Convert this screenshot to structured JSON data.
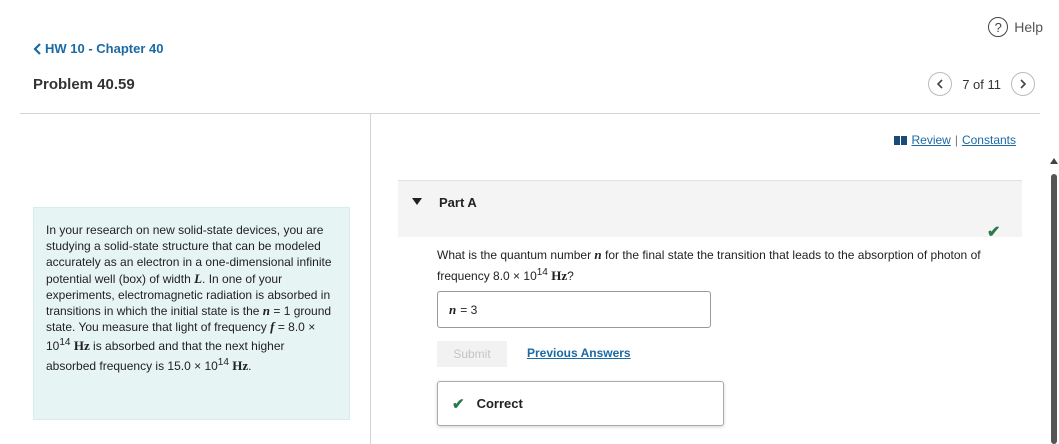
{
  "header": {
    "help_label": "Help",
    "help_icon": "question-circle-icon",
    "back_label": "HW 10 - Chapter 40",
    "problem_title": "Problem 40.59",
    "pager": {
      "text": "7 of 11"
    }
  },
  "links": {
    "review": "Review",
    "separator": "|",
    "constants": "Constants"
  },
  "context": {
    "p1": "In your research on new solid-state devices, you are studying a solid-state structure that can be modeled accurately as an electron in a one-dimensional infinite potential well (box) of width ",
    "var_L": "L",
    "p2": ". In one of your experiments, electromagnetic radiation is absorbed in transitions in which the initial state is the ",
    "var_n": "n",
    "p3": " = 1 ground state. You measure that light of frequency ",
    "var_f": "f",
    "p4": " = 8.0 × 10",
    "exp1": "14",
    "unit1": "Hz",
    "p5": " is absorbed and that the next higher absorbed frequency is 15.0 × 10",
    "exp2": "14",
    "unit2": "Hz",
    "p6": "."
  },
  "part": {
    "label": "Part A",
    "question_p1": "What is the quantum number ",
    "question_var": "n",
    "question_p2": " for the final state the transition that leads to the absorption of photon of frequency 8.0 × 10",
    "question_exp": "14",
    "question_unit": "Hz",
    "question_p3": "?",
    "answer_var": "n",
    "answer_eq": "= ",
    "answer_value": "3",
    "submit_label": "Submit",
    "previous_answers": "Previous Answers",
    "feedback": "Correct"
  },
  "colors": {
    "link": "#1a6aa5",
    "correct_green": "#2a7a4b",
    "context_bg": "#e7f4f4"
  }
}
